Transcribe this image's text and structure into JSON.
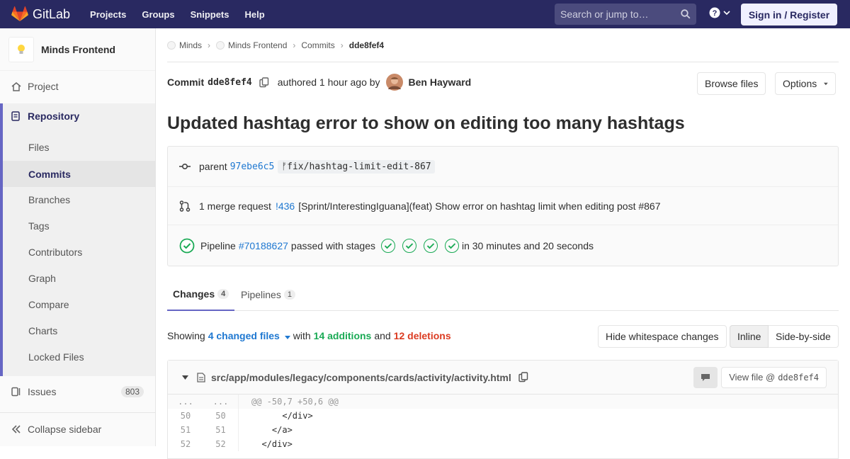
{
  "topbar": {
    "brand": "GitLab",
    "nav": [
      "Projects",
      "Groups",
      "Snippets",
      "Help"
    ],
    "search_placeholder": "Search or jump to…",
    "signin": "Sign in / Register"
  },
  "sidebar": {
    "project_name": "Minds Frontend",
    "project_label": "Project",
    "repository_label": "Repository",
    "repo_items": [
      "Files",
      "Commits",
      "Branches",
      "Tags",
      "Contributors",
      "Graph",
      "Compare",
      "Charts",
      "Locked Files"
    ],
    "active_item": "Commits",
    "issues_label": "Issues",
    "issues_count": "803",
    "collapse_label": "Collapse sidebar"
  },
  "breadcrumb": [
    "Minds",
    "Minds Frontend",
    "Commits",
    "dde8fef4"
  ],
  "commit": {
    "label": "Commit",
    "sha": "dde8fef4",
    "authored": "authored 1 hour ago by",
    "author": "Ben Hayward",
    "browse_files": "Browse files",
    "options": "Options",
    "title": "Updated hashtag error to show on editing too many hashtags",
    "parent_label": "parent",
    "parent_sha": "97ebe6c5",
    "branch": "fix/hashtag-limit-edit-867",
    "mr_text": "1 merge request",
    "mr_link": "!436",
    "mr_title": "[Sprint/InterestingIguana](feat) Show error on hashtag limit when editing post #867",
    "pipeline_label": "Pipeline",
    "pipeline_link": "#70188627",
    "pipeline_status": "passed with stages",
    "pipeline_duration": "in 30 minutes and 20 seconds"
  },
  "tabs": [
    {
      "label": "Changes",
      "count": "4"
    },
    {
      "label": "Pipelines",
      "count": "1"
    }
  ],
  "diff_summary": {
    "showing": "Showing",
    "changed_files": "4 changed files",
    "with": "with",
    "additions": "14 additions",
    "and": "and",
    "deletions": "12 deletions",
    "hide_whitespace": "Hide whitespace changes",
    "inline": "Inline",
    "side_by_side": "Side-by-side"
  },
  "file": {
    "path": "src/app/modules/legacy/components/cards/activity/activity.html",
    "view_file": "View file @",
    "view_sha": "dde8fef4",
    "hunk": "@@ -50,7 +50,6 @@",
    "lines": [
      {
        "old": "50",
        "new": "50",
        "code": "      </div>"
      },
      {
        "old": "51",
        "new": "51",
        "code": "    </a>"
      },
      {
        "old": "52",
        "new": "52",
        "code": "  </div>"
      }
    ]
  },
  "colors": {
    "topbar": "#292961",
    "link": "#1f78d1",
    "success": "#1aaa55",
    "danger": "#db3b21"
  }
}
